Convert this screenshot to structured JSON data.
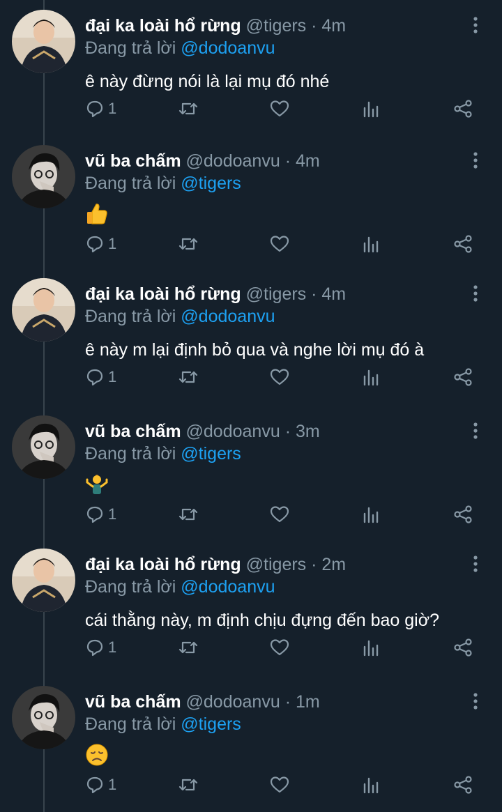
{
  "theme": {
    "background": "#15202b",
    "text": "#ffffff",
    "muted": "#8899a6",
    "accent": "#1da1f2",
    "thread_line": "#38444d"
  },
  "tweets": [
    {
      "author": "đại ka loài hổ rừng",
      "handle": "@tigers",
      "sep": "·",
      "time": "4m",
      "reply_prefix": "Đang trả lời",
      "reply_to": "@dodoanvu",
      "text": "ê này đừng nói là lại mụ đó nhé",
      "emoji": null,
      "reply_count": "1",
      "avatar": "tiger-avatar"
    },
    {
      "author": "vũ ba chấm",
      "handle": "@dodoanvu",
      "sep": "·",
      "time": "4m",
      "reply_prefix": "Đang trả lời",
      "reply_to": "@tigers",
      "text": "",
      "emoji": "thumbs-up-emoji",
      "reply_count": "1",
      "avatar": "vu-avatar"
    },
    {
      "author": "đại ka loài hổ rừng",
      "handle": "@tigers",
      "sep": "·",
      "time": "4m",
      "reply_prefix": "Đang trả lời",
      "reply_to": "@dodoanvu",
      "text": "ê này m lại định bỏ qua và nghe lời mụ đó à",
      "emoji": null,
      "reply_count": "1",
      "avatar": "tiger-avatar"
    },
    {
      "author": "vũ ba chấm",
      "handle": "@dodoanvu",
      "sep": "·",
      "time": "3m",
      "reply_prefix": "Đang trả lời",
      "reply_to": "@tigers",
      "text": "",
      "emoji": "person-shrugging-emoji",
      "reply_count": "1",
      "avatar": "vu-avatar"
    },
    {
      "author": "đại ka loài hổ rừng",
      "handle": "@tigers",
      "sep": "·",
      "time": "2m",
      "reply_prefix": "Đang trả lời",
      "reply_to": "@dodoanvu",
      "text": "cái thằng này, m định chịu đựng đến bao giờ?",
      "emoji": null,
      "reply_count": "1",
      "avatar": "tiger-avatar"
    },
    {
      "author": "vũ ba chấm",
      "handle": "@dodoanvu",
      "sep": "·",
      "time": "1m",
      "reply_prefix": "Đang trả lời",
      "reply_to": "@tigers",
      "text": "",
      "emoji": "disappointed-face-emoji",
      "reply_count": "1",
      "avatar": "vu-avatar"
    }
  ],
  "action_icons": [
    "reply-icon",
    "retweet-icon",
    "like-icon",
    "analytics-icon",
    "share-icon"
  ]
}
